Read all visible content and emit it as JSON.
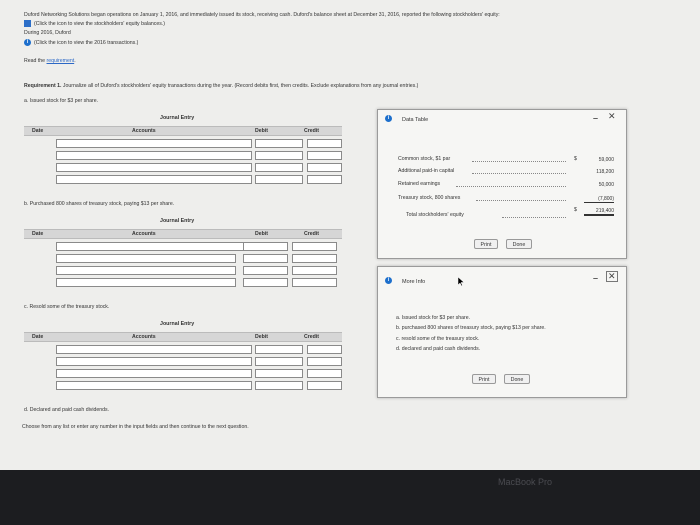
{
  "intro": {
    "line1": "Duford Networking Solutions began operations on January 1, 2016, and immediately issued its stock, receiving cash. Duford's balance sheet at December 31, 2016, reported the following stockholders' equity:",
    "line2": "(Click the icon to view the stockholders' equity balances.)",
    "line3": "During 2016, Duford",
    "line4": "(Click the icon to view the 2016 transactions.)",
    "read_prefix": "Read the ",
    "read_link": "requirement",
    "read_suffix": "."
  },
  "requirement": {
    "label": "Requirement 1.",
    "text": " Journalize all of Duford's stockholders' equity transactions during the year. (Record debits first, then credits. Exclude explanations from any journal entries.)"
  },
  "journal_headers": {
    "title": "Journal Entry",
    "date": "Date",
    "accounts": "Accounts",
    "debit": "Debit",
    "credit": "Credit"
  },
  "sections": {
    "a": "a. Issued stock for $3 per share.",
    "b": "b. Purchased 800 shares of treasury stock, paying $13 per share.",
    "c": "c. Resold some of the treasury stock.",
    "d": "d. Declared and paid cash dividends."
  },
  "footer_instruction": "Choose from any list or enter any number in the input fields and then continue to the next question.",
  "data_table": {
    "title": "Data Table",
    "rows": [
      {
        "label": "Common stock, $1 par",
        "currency": "$",
        "value": "59,000"
      },
      {
        "label": "Additional paid-in capital",
        "currency": "",
        "value": "118,200"
      },
      {
        "label": "Retained earnings",
        "currency": "",
        "value": "50,000"
      },
      {
        "label": "Treasury stock, 800 shares",
        "currency": "",
        "value": "(7,800)"
      }
    ],
    "total": {
      "label": "Total stockholders' equity",
      "currency": "$",
      "value": "219,400"
    },
    "print": "Print",
    "done": "Done"
  },
  "more_info": {
    "title": "More Info",
    "items": [
      "a.  Issued stock for $3 per share.",
      "b.  purchased 800 shares of treasury stock, paying $13 per share.",
      "c.  resold some of the treasury stock.",
      "d.  declared and paid cash dividends."
    ],
    "print": "Print",
    "done": "Done"
  },
  "device_label": "MacBook Pro",
  "icons": {
    "info": "i",
    "grid": "table-icon",
    "minus": "–",
    "close": "✕"
  },
  "colors": {
    "link": "#2c68c6",
    "info_icon": "#1d6fcc",
    "header_bg": "#d6d6d6"
  }
}
